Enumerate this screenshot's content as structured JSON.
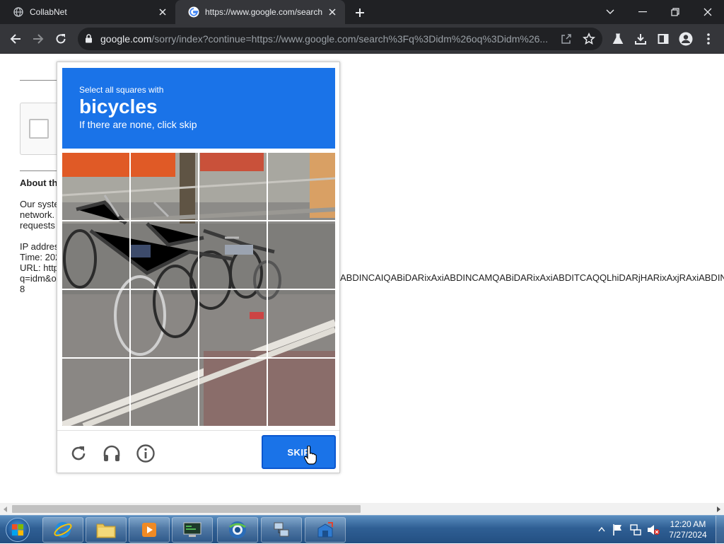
{
  "browser": {
    "tabs": [
      {
        "title": "CollabNet",
        "favicon": "globe-icon"
      },
      {
        "title": "https://www.google.com/search?q",
        "favicon": "google-g-icon",
        "active": true
      }
    ],
    "url_host": "google.com",
    "url_rest": "/sorry/index?continue=https://www.google.com/search%3Fq%3Didm%26oq%3Didm%26..."
  },
  "page": {
    "about_heading": "About th",
    "body_lines": [
      "Our syste",
      "network.",
      "requests"
    ],
    "info_lines": [
      "IP addres",
      "Time: 202",
      "URL: http",
      "q=idm&o",
      "8"
    ],
    "long_line": "ABDINCAIQABiDARixAxiABDINCAMQABiDARixAxiABDITCAQQLhiDARjHARixAxjRAxiABDINC"
  },
  "captcha": {
    "instruction": "Select all squares with",
    "target": "bicycles",
    "hint": "If there are none, click skip",
    "skip_label": "SKIP",
    "footer_icons": [
      "reload-icon",
      "headphones-icon",
      "info-icon"
    ],
    "accent": "#1a73e8"
  },
  "taskbar": {
    "time": "12:20 AM",
    "date": "7/27/2024"
  }
}
